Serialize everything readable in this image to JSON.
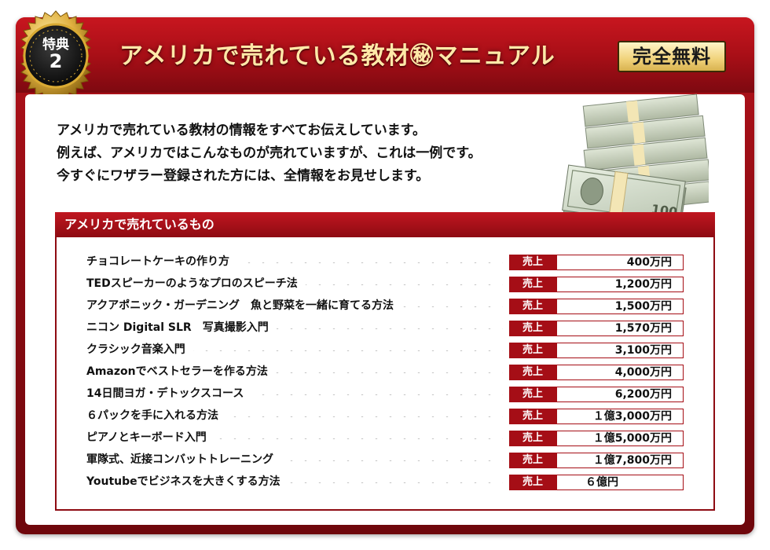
{
  "header": {
    "title": "アメリカで売れている教材㊙マニュアル",
    "badge": "完全無料",
    "medal": {
      "line1": "特典",
      "line2": "2"
    }
  },
  "intro": [
    "アメリカで売れている教材の情報をすべてお伝えしています。",
    "例えば、アメリカではこんなものが売れていますが、これは一例です。",
    "今すぐにワザラー登録された方には、全情報をお見せします。"
  ],
  "list": {
    "heading": "アメリカで売れているもの",
    "tag_label": "売上",
    "items": [
      {
        "name": "チョコレートケーキの作り方",
        "amount": "400万円"
      },
      {
        "name": "TEDスピーカーのようなプロのスピーチ法",
        "amount": "1,200万円"
      },
      {
        "name": "アクアポニック・ガーデニング　魚と野菜を一緒に育てる方法",
        "amount": "1,500万円"
      },
      {
        "name": "ニコン Digital SLR　写真撮影入門",
        "amount": "1,570万円"
      },
      {
        "name": "クラシック音楽入門",
        "amount": "3,100万円"
      },
      {
        "name": "Amazonでベストセラーを作る方法",
        "amount": "4,000万円"
      },
      {
        "name": "14日間ヨガ・デトックスコース",
        "amount": "6,200万円"
      },
      {
        "name": "６パックを手に入れる方法",
        "amount": "１億3,000万円"
      },
      {
        "name": "ピアノとキーボード入門",
        "amount": "１億5,000万円"
      },
      {
        "name": "軍隊式、近接コンバットトレーニング",
        "amount": "１億7,800万円"
      },
      {
        "name": "Youtubeでビジネスを大きくする方法",
        "amount": "６億円"
      }
    ]
  },
  "colors": {
    "brand_red": "#a50e16",
    "gold": "#d8b24f",
    "title_text": "#ffe9a8"
  },
  "illustration": {
    "icon": "money-stack-icon",
    "bill_text": "100"
  }
}
